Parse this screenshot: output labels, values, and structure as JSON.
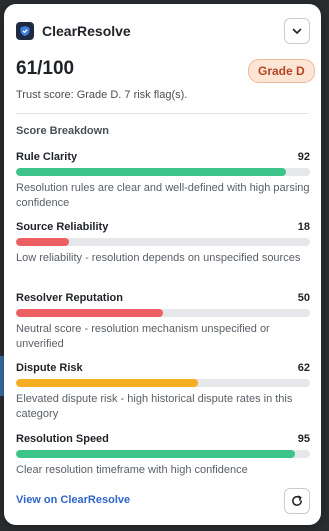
{
  "header": {
    "brand": "ClearResolve",
    "logo_icon": "shield-check-icon",
    "collapse_icon": "chevron-down-icon"
  },
  "score": {
    "value": "61/100",
    "grade": "Grade D",
    "summary": "Trust score: Grade D. 7 risk flag(s)."
  },
  "breakdown": {
    "title": "Score Breakdown",
    "metrics": [
      {
        "name": "Rule Clarity",
        "value": "92",
        "percent": 92,
        "color": "#3cc48a",
        "description": "Resolution rules are clear and well-defined with high parsing confidence"
      },
      {
        "name": "Source Reliability",
        "value": "18",
        "percent": 18,
        "color": "#ec5f63",
        "description": "Low reliability - resolution depends on unspecified sources"
      },
      {
        "name": "Resolver Reputation",
        "value": "50",
        "percent": 50,
        "color": "#ec5f63",
        "description": "Neutral score - resolution mechanism unspecified or unverified"
      },
      {
        "name": "Dispute Risk",
        "value": "62",
        "percent": 62,
        "color": "#f5ad22",
        "description": "Elevated dispute risk - high historical dispute rates in this category"
      },
      {
        "name": "Resolution Speed",
        "value": "95",
        "percent": 95,
        "color": "#3cc48a",
        "description": "Clear resolution timeframe with high confidence"
      }
    ]
  },
  "footer": {
    "link": "View on ClearResolve",
    "refresh_icon": "refresh-icon"
  }
}
